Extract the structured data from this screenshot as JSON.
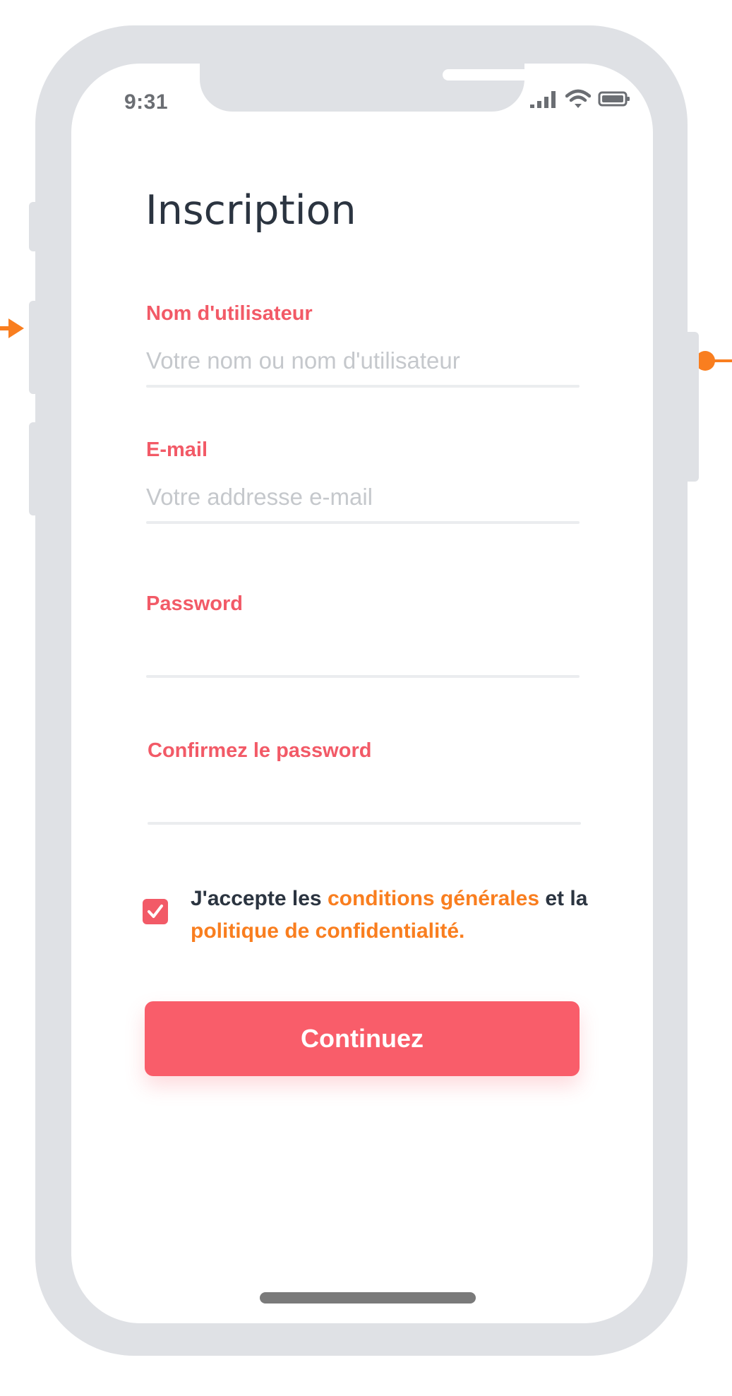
{
  "status_bar": {
    "time": "9:31",
    "icons": [
      "signal-icon",
      "wifi-icon",
      "battery-icon"
    ]
  },
  "page": {
    "title": "Inscription"
  },
  "form": {
    "username": {
      "label": "Nom d'utilisateur",
      "placeholder": "Votre nom ou nom d'utilisateur",
      "value": ""
    },
    "email": {
      "label": "E-mail",
      "placeholder": "Votre addresse e-mail",
      "value": ""
    },
    "password": {
      "label": "Password",
      "placeholder": "",
      "value": ""
    },
    "confirm_password": {
      "label": "Confirmez le password",
      "placeholder": "",
      "value": ""
    },
    "consent": {
      "checked": true,
      "text_before": "J'accepte les ",
      "terms_link": "conditions générales",
      "text_middle": " et la",
      "privacy_link": "politique de confidentialité."
    },
    "submit_label": "Continuez"
  },
  "colors": {
    "accent": "#f95d6a",
    "label": "#f25a67",
    "link": "#f97e1f",
    "title": "#2b3440",
    "frame": "#dfe1e5",
    "pointer": "#f97e1f"
  }
}
